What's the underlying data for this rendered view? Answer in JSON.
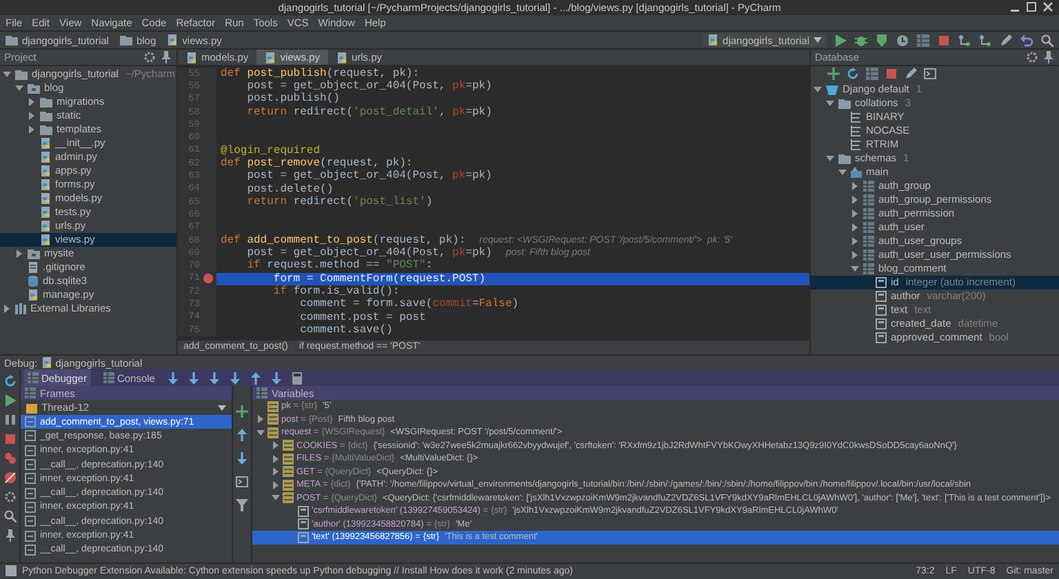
{
  "window": {
    "title": "djangogirls_tutorial [~/PycharmProjects/djangogirls_tutorial] - .../blog/views.py [djangogirls_tutorial] - PyCharm"
  },
  "menu": [
    "File",
    "Edit",
    "View",
    "Navigate",
    "Code",
    "Refactor",
    "Run",
    "Tools",
    "VCS",
    "Window",
    "Help"
  ],
  "breadcrumbs": [
    "djangogirls_tutorial",
    "blog",
    "views.py"
  ],
  "run_config": "djangogirls_tutorial",
  "project": {
    "title": "Project",
    "tree": [
      {
        "label": "djangogirls_tutorial",
        "note": "~/Pycharm",
        "kind": "folder",
        "expanded": true,
        "selected": false,
        "children": [
          {
            "label": "blog",
            "kind": "package",
            "expanded": true,
            "selected": false,
            "children": [
              {
                "label": "migrations",
                "kind": "folder",
                "expanded": false,
                "selected": false
              },
              {
                "label": "static",
                "kind": "folder",
                "expanded": false,
                "selected": false
              },
              {
                "label": "templates",
                "kind": "folder",
                "expanded": false,
                "selected": false
              },
              {
                "label": "__init__.py",
                "kind": "python",
                "selected": false
              },
              {
                "label": "admin.py",
                "kind": "python",
                "selected": false
              },
              {
                "label": "apps.py",
                "kind": "python",
                "selected": false
              },
              {
                "label": "forms.py",
                "kind": "python",
                "selected": false
              },
              {
                "label": "models.py",
                "kind": "python",
                "selected": false
              },
              {
                "label": "tests.py",
                "kind": "python",
                "selected": false
              },
              {
                "label": "urls.py",
                "kind": "python",
                "selected": false
              },
              {
                "label": "views.py",
                "kind": "python",
                "selected": true
              }
            ]
          },
          {
            "label": "mysite",
            "kind": "package",
            "expanded": false,
            "selected": false
          },
          {
            "label": ".gitignore",
            "kind": "text",
            "selected": false
          },
          {
            "label": "db.sqlite3",
            "kind": "db",
            "selected": false
          },
          {
            "label": "manage.py",
            "kind": "python",
            "selected": false
          }
        ]
      },
      {
        "label": "External Libraries",
        "kind": "libraries",
        "expanded": false,
        "selected": false
      }
    ]
  },
  "editor": {
    "tabs": [
      {
        "label": "models.py",
        "selected": false
      },
      {
        "label": "views.py",
        "selected": true
      },
      {
        "label": "urls.py",
        "selected": false
      }
    ],
    "lines": [
      {
        "number": "55",
        "breakpoint": false,
        "current": false,
        "segments": [
          {
            "kind": "kw",
            "text": "def "
          },
          {
            "kind": "fn",
            "text": "post_publish"
          },
          {
            "kind": "plain",
            "text": "(request, pk):"
          }
        ]
      },
      {
        "number": "56",
        "breakpoint": false,
        "current": false,
        "segments": [
          {
            "kind": "plain",
            "text": "    post = get_object_or_404(Post, "
          },
          {
            "kind": "param",
            "text": "pk"
          },
          {
            "kind": "plain",
            "text": "=pk)"
          }
        ]
      },
      {
        "number": "57",
        "breakpoint": false,
        "current": false,
        "segments": [
          {
            "kind": "plain",
            "text": "    post.publish()"
          }
        ]
      },
      {
        "number": "58",
        "breakpoint": false,
        "current": false,
        "segments": [
          {
            "kind": "kw",
            "text": "    return "
          },
          {
            "kind": "plain",
            "text": "redirect("
          },
          {
            "kind": "str",
            "text": "'post_detail'"
          },
          {
            "kind": "plain",
            "text": ", "
          },
          {
            "kind": "param",
            "text": "pk"
          },
          {
            "kind": "plain",
            "text": "=pk)"
          }
        ]
      },
      {
        "number": "59",
        "breakpoint": false,
        "current": false
      },
      {
        "number": "60",
        "breakpoint": false,
        "current": false
      },
      {
        "number": "61",
        "breakpoint": false,
        "current": false,
        "segments": [
          {
            "kind": "deco",
            "text": "@login_required"
          }
        ]
      },
      {
        "number": "62",
        "breakpoint": false,
        "current": false,
        "segments": [
          {
            "kind": "kw",
            "text": "def "
          },
          {
            "kind": "fn",
            "text": "post_remove"
          },
          {
            "kind": "plain",
            "text": "(request, pk):"
          }
        ]
      },
      {
        "number": "63",
        "breakpoint": false,
        "current": false,
        "segments": [
          {
            "kind": "plain",
            "text": "    post = get_object_or_404(Post, "
          },
          {
            "kind": "param",
            "text": "pk"
          },
          {
            "kind": "plain",
            "text": "=pk)"
          }
        ]
      },
      {
        "number": "64",
        "breakpoint": false,
        "current": false,
        "segments": [
          {
            "kind": "plain",
            "text": "    post.delete()"
          }
        ]
      },
      {
        "number": "65",
        "breakpoint": false,
        "current": false,
        "segments": [
          {
            "kind": "kw",
            "text": "    return "
          },
          {
            "kind": "plain",
            "text": "redirect("
          },
          {
            "kind": "str",
            "text": "'post_list'"
          },
          {
            "kind": "plain",
            "text": ")"
          }
        ]
      },
      {
        "number": "66",
        "breakpoint": false,
        "current": false
      },
      {
        "number": "67",
        "breakpoint": false,
        "current": false
      },
      {
        "number": "68",
        "breakpoint": false,
        "current": false,
        "segments": [
          {
            "kind": "kw",
            "text": "def "
          },
          {
            "kind": "fn",
            "text": "add_comment_to_post"
          },
          {
            "kind": "plain",
            "text": "(request, pk):"
          },
          {
            "kind": "hint",
            "text": "request: <WSGIRequest: POST '/post/5/comment/'>  pk: '5'"
          }
        ]
      },
      {
        "number": "69",
        "breakpoint": false,
        "current": false,
        "segments": [
          {
            "kind": "plain",
            "text": "    post = get_object_or_404(Post, "
          },
          {
            "kind": "param",
            "text": "pk"
          },
          {
            "kind": "plain",
            "text": "=pk)"
          },
          {
            "kind": "hint",
            "text": "post: Fifth blog post"
          }
        ]
      },
      {
        "number": "70",
        "breakpoint": false,
        "current": false,
        "segments": [
          {
            "kind": "kw",
            "text": "    if "
          },
          {
            "kind": "plain",
            "text": "request.method == "
          },
          {
            "kind": "str",
            "text": "\"POST\""
          },
          {
            "kind": "plain",
            "text": ":"
          }
        ]
      },
      {
        "number": "71",
        "breakpoint": true,
        "current": true,
        "segments": [
          {
            "kind": "plain",
            "text": "        form = CommentForm(request.POST)"
          }
        ]
      },
      {
        "number": "72",
        "breakpoint": false,
        "current": false,
        "segments": [
          {
            "kind": "kw",
            "text": "        if "
          },
          {
            "kind": "plain",
            "text": "form.is_valid():"
          }
        ]
      },
      {
        "number": "73",
        "breakpoint": false,
        "current": false,
        "segments": [
          {
            "kind": "plain",
            "text": "            comment = form.save("
          },
          {
            "kind": "param",
            "text": "commit"
          },
          {
            "kind": "plain",
            "text": "="
          },
          {
            "kind": "kw",
            "text": "False"
          },
          {
            "kind": "plain",
            "text": ")"
          }
        ]
      },
      {
        "number": "74",
        "breakpoint": false,
        "current": false,
        "segments": [
          {
            "kind": "plain",
            "text": "            comment.post = post"
          }
        ]
      },
      {
        "number": "75",
        "breakpoint": false,
        "current": false,
        "segments": [
          {
            "kind": "plain",
            "text": "            comment.save()"
          }
        ]
      }
    ],
    "footer": [
      "add_comment_to_post()",
      "if request.method == 'POST'"
    ]
  },
  "database": {
    "title": "Database",
    "tree": [
      {
        "label": "Django default",
        "note": "1",
        "kind": "connection",
        "expanded": true,
        "selected": false,
        "children": [
          {
            "label": "collations",
            "note": "3",
            "kind": "folder",
            "expanded": true,
            "selected": false,
            "children": [
              {
                "label": "BINARY",
                "kind": "collation",
                "selected": false
              },
              {
                "label": "NOCASE",
                "kind": "collation",
                "selected": false
              },
              {
                "label": "RTRIM",
                "kind": "collation",
                "selected": false
              }
            ]
          },
          {
            "label": "schemas",
            "note": "1",
            "kind": "folder",
            "expanded": true,
            "selected": false,
            "children": [
              {
                "label": "main",
                "kind": "schema",
                "expanded": true,
                "selected": false,
                "children": [
                  {
                    "label": "auth_group",
                    "kind": "table",
                    "expanded": false,
                    "selected": false
                  },
                  {
                    "label": "auth_group_permissions",
                    "kind": "table",
                    "expanded": false,
                    "selected": false
                  },
                  {
                    "label": "auth_permission",
                    "kind": "table",
                    "expanded": false,
                    "selected": false
                  },
                  {
                    "label": "auth_user",
                    "kind": "table",
                    "expanded": false,
                    "selected": false
                  },
                  {
                    "label": "auth_user_groups",
                    "kind": "table",
                    "expanded": false,
                    "selected": false
                  },
                  {
                    "label": "auth_user_user_permissions",
                    "kind": "table",
                    "expanded": false,
                    "selected": false
                  },
                  {
                    "label": "blog_comment",
                    "kind": "table",
                    "expanded": true,
                    "selected": false,
                    "children": [
                      {
                        "label": "id",
                        "note": "integer (auto increment)",
                        "kind": "column",
                        "selected": true
                      },
                      {
                        "label": "author",
                        "note": "varchar(200)",
                        "kind": "column",
                        "selected": false
                      },
                      {
                        "label": "text",
                        "note": "text",
                        "kind": "column",
                        "selected": false
                      },
                      {
                        "label": "created_date",
                        "note": "datetime",
                        "kind": "column",
                        "selected": false
                      },
                      {
                        "label": "approved_comment",
                        "note": "bool",
                        "kind": "column",
                        "selected": false
                      }
                    ]
                  }
                ]
              }
            ]
          }
        ]
      }
    ]
  },
  "debug": {
    "title": "Debug:",
    "config": "djangogirls_tutorial",
    "tabs": [
      {
        "label": "Debugger",
        "selected": true
      },
      {
        "label": "Console",
        "selected": false
      }
    ],
    "frames_title": "Frames",
    "thread": "Thread-12",
    "frames": [
      {
        "label": "add_comment_to_post, views.py:71",
        "selected": true
      },
      {
        "label": "_get_response, base.py:185",
        "selected": false
      },
      {
        "label": "inner, exception.py:41",
        "selected": false
      },
      {
        "label": "__call__, deprecation.py:140",
        "selected": false
      },
      {
        "label": "inner, exception.py:41",
        "selected": false
      },
      {
        "label": "__call__, deprecation.py:140",
        "selected": false
      },
      {
        "label": "inner, exception.py:41",
        "selected": false
      },
      {
        "label": "__call__, deprecation.py:140",
        "selected": false
      },
      {
        "label": "inner, exception.py:41",
        "selected": false
      },
      {
        "label": "__call__, deprecation.py:140",
        "selected": false
      }
    ],
    "variables_title": "Variables",
    "variables": [
      {
        "name": "pk =",
        "type": "{str}",
        "value": "'5'",
        "selected": false
      },
      {
        "name": "post =",
        "type": "{Post}",
        "value": "Fifth blog post",
        "expanded": false,
        "selected": false
      },
      {
        "name": "request =",
        "type": "{WSGIRequest}",
        "value": "<WSGIRequest: POST '/post/5/comment/'>",
        "expanded": true,
        "selected": false,
        "children": [
          {
            "name": "COOKIES =",
            "type": "{dict}",
            "value": "{'sessionid': 'w3e27wee5k2muajkr662vbyydwujef', 'csrftoken': 'RXxfm9z1jbJ2RdWhtFVYbKOwyXHHetabz13Q9z9I0YdC0kwsDSoDD5cay6aoNnQ'}",
            "expanded": false,
            "selected": false
          },
          {
            "name": "FILES =",
            "type": "{MultiValueDict}",
            "value": "<MultiValueDict: {}>",
            "expanded": false,
            "selected": false
          },
          {
            "name": "GET =",
            "type": "{QueryDict}",
            "value": "<QueryDict: {}>",
            "expanded": false,
            "selected": false
          },
          {
            "name": "META =",
            "type": "{dict}",
            "value": "{'PATH': '/home/filippov/virtual_environments/djangogirls_tutorial/bin:/bin/:/sbin/:/games/:/bin/:/sbin/:/home/filippov/bin:/home/filippov/.local/bin:/usr/local/sbin",
            "expanded": false,
            "selected": false
          },
          {
            "name": "POST =",
            "type": "{QueryDict}",
            "value": "<QueryDict: {'csrfmiddlewaretoken': ['jsXlh1VxzwpzoiKmW9m2jkvandfuZ2VDZ6SL1VFY9kdXY9aRlmEHLCL0jAWhW0'], 'author': ['Me'], 'text': ['This is a test comment']}>",
            "expanded": true,
            "selected": false,
            "children": [
              {
                "name": "'csrfmiddlewaretoken' (139927459053424) =",
                "type": "{str}",
                "value": "'jsXlh1VxzwpzoiKmW9m2jkvandfuZ2VDZ6SL1VFY9kdXY9aRlmEHLCL0jAWhW0'",
                "selected": false
              },
              {
                "name": "'author' (139923458820784) =",
                "type": "{str}",
                "value": "'Me'",
                "selected": false
              },
              {
                "name": "'text' (139923456827856) =",
                "type": "{str}",
                "value": "'This is a test comment'",
                "selected": true
              }
            ]
          }
        ]
      }
    ]
  },
  "status_bar": {
    "message": "Python Debugger Extension Available: Cython extension speeds up Python debugging // Install How does it work (2 minutes ago)",
    "items": [
      "73:2",
      "LF",
      "UTF-8",
      "Git: master"
    ]
  }
}
